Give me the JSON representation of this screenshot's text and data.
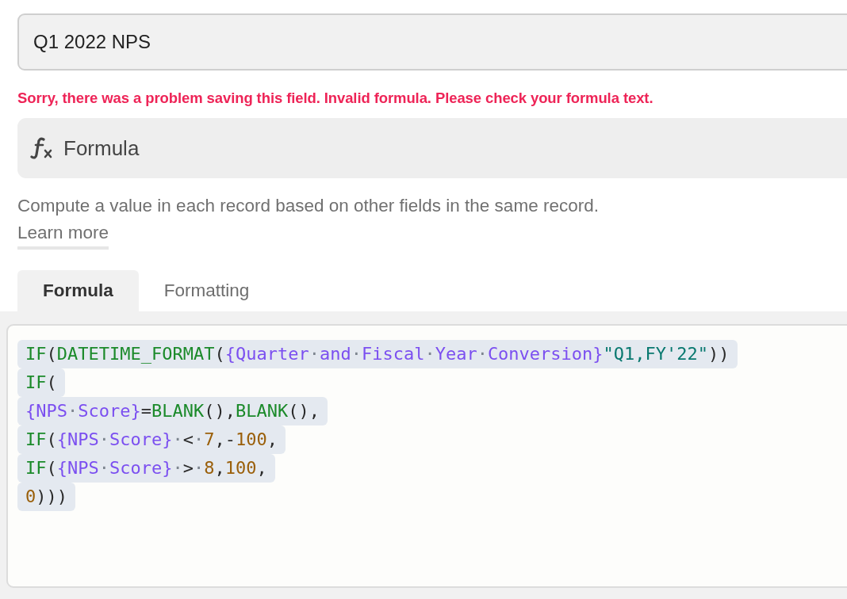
{
  "name_field": {
    "value": "Q1 2022 NPS"
  },
  "error_message": "Sorry, there was a problem saving this field. Invalid formula. Please check your formula text.",
  "field_type": {
    "label": "Formula"
  },
  "description": "Compute a value in each record based on other fields in the same record.",
  "learn_more": "Learn more",
  "tabs": [
    {
      "label": "Formula",
      "selected": true
    },
    {
      "label": "Formatting",
      "selected": false
    }
  ],
  "formula_lines": [
    [
      {
        "kind": "function",
        "text": "IF"
      },
      {
        "kind": "punct",
        "text": "("
      },
      {
        "kind": "function",
        "text": "DATETIME_FORMAT"
      },
      {
        "kind": "punct",
        "text": "("
      },
      {
        "kind": "field",
        "text": "{Quarter"
      },
      {
        "kind": "space",
        "text": "·"
      },
      {
        "kind": "field",
        "text": "and"
      },
      {
        "kind": "space",
        "text": "·"
      },
      {
        "kind": "field",
        "text": "Fiscal"
      },
      {
        "kind": "space",
        "text": "·"
      },
      {
        "kind": "field",
        "text": "Year"
      },
      {
        "kind": "space",
        "text": "·"
      },
      {
        "kind": "field",
        "text": "Conversion}"
      },
      {
        "kind": "string",
        "text": "\"Q1,FY'22\""
      },
      {
        "kind": "punct",
        "text": "))"
      }
    ],
    [
      {
        "kind": "function",
        "text": "IF"
      },
      {
        "kind": "punct",
        "text": "("
      }
    ],
    [
      {
        "kind": "field",
        "text": "{NPS"
      },
      {
        "kind": "space",
        "text": "·"
      },
      {
        "kind": "field",
        "text": "Score}"
      },
      {
        "kind": "punct",
        "text": "="
      },
      {
        "kind": "function",
        "text": "BLANK"
      },
      {
        "kind": "punct",
        "text": "(),"
      },
      {
        "kind": "function",
        "text": "BLANK"
      },
      {
        "kind": "punct",
        "text": "(),"
      }
    ],
    [
      {
        "kind": "function",
        "text": "IF"
      },
      {
        "kind": "punct",
        "text": "("
      },
      {
        "kind": "field",
        "text": "{NPS"
      },
      {
        "kind": "space",
        "text": "·"
      },
      {
        "kind": "field",
        "text": "Score}"
      },
      {
        "kind": "space",
        "text": "·"
      },
      {
        "kind": "punct",
        "text": "<"
      },
      {
        "kind": "space",
        "text": "·"
      },
      {
        "kind": "number",
        "text": "7"
      },
      {
        "kind": "punct",
        "text": ",-"
      },
      {
        "kind": "number",
        "text": "100"
      },
      {
        "kind": "punct",
        "text": ","
      }
    ],
    [
      {
        "kind": "function",
        "text": "IF"
      },
      {
        "kind": "punct",
        "text": "("
      },
      {
        "kind": "field",
        "text": "{NPS"
      },
      {
        "kind": "space",
        "text": "·"
      },
      {
        "kind": "field",
        "text": "Score}"
      },
      {
        "kind": "space",
        "text": "·"
      },
      {
        "kind": "punct",
        "text": ">"
      },
      {
        "kind": "space",
        "text": "·"
      },
      {
        "kind": "number",
        "text": "8"
      },
      {
        "kind": "punct",
        "text": ","
      },
      {
        "kind": "number",
        "text": "100"
      },
      {
        "kind": "punct",
        "text": ","
      }
    ],
    [
      {
        "kind": "number",
        "text": "0"
      },
      {
        "kind": "punct",
        "text": ")))"
      }
    ]
  ]
}
